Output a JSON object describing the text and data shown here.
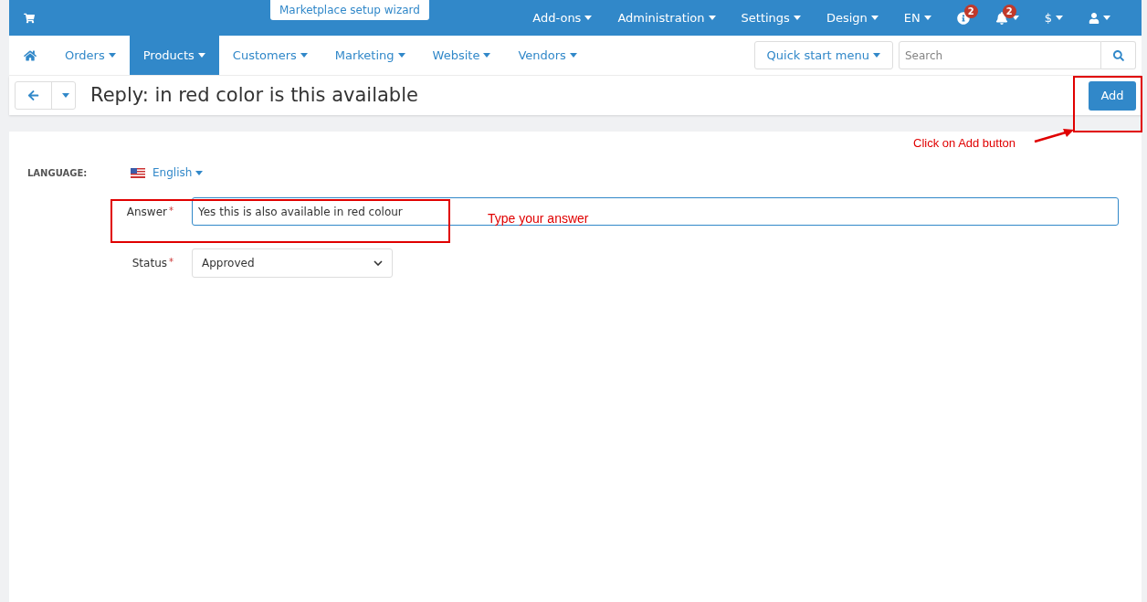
{
  "top_bar": {
    "wizard": "Marketplace setup wizard",
    "menus": [
      {
        "label": "Add-ons",
        "kind": "text"
      },
      {
        "label": "Administration",
        "kind": "text"
      },
      {
        "label": "Settings",
        "kind": "text"
      },
      {
        "label": "Design",
        "kind": "text"
      },
      {
        "label": "EN",
        "kind": "text"
      },
      {
        "kind": "info",
        "badge": "2"
      },
      {
        "kind": "bell",
        "badge": "2"
      },
      {
        "label": "$",
        "kind": "text"
      },
      {
        "kind": "user"
      }
    ]
  },
  "nav": {
    "items": [
      {
        "label": "Orders",
        "selected": false
      },
      {
        "label": "Products",
        "selected": true
      },
      {
        "label": "Customers",
        "selected": false
      },
      {
        "label": "Marketing",
        "selected": false
      },
      {
        "label": "Website",
        "selected": false
      },
      {
        "label": "Vendors",
        "selected": false
      }
    ],
    "quick_start": "Quick start menu",
    "search": {
      "placeholder": "Search"
    }
  },
  "title": "Reply: in red color is this available",
  "add_button": "Add",
  "form": {
    "language_label": "LANGUAGE:",
    "language": "English",
    "fields": [
      {
        "label": "Answer",
        "required_mark": "*",
        "kind": "input",
        "value": "Yes this is also available in red colour"
      },
      {
        "label": "Status",
        "required_mark": "*",
        "kind": "select",
        "value": "Approved"
      }
    ]
  },
  "annotations": [
    "Click on Add button",
    "Type your answer"
  ]
}
